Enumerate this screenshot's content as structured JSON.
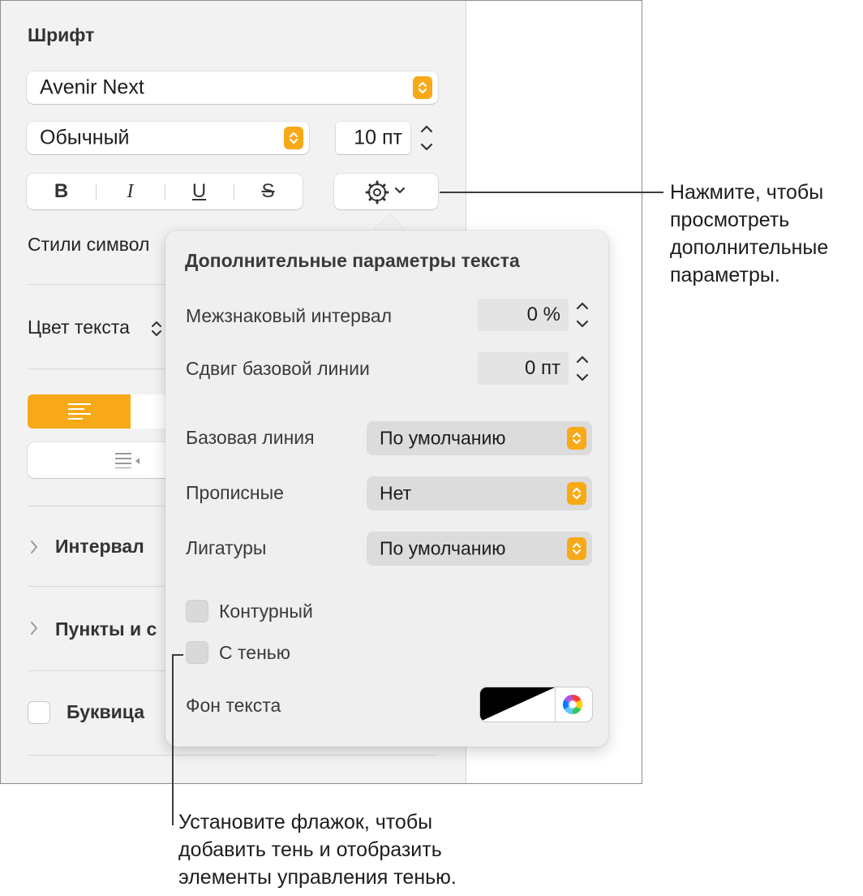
{
  "sidebar": {
    "font_header": "Шрифт",
    "font_family": "Avenir Next",
    "font_style": "Обычный",
    "font_size": "10 пт",
    "bold": "B",
    "italic": "I",
    "underline": "U",
    "strike": "S",
    "char_styles": "Стили символ",
    "text_color": "Цвет текста",
    "spacing": "Интервал",
    "bullets": "Пункты и с",
    "drop_cap": "Буквица"
  },
  "popover": {
    "title": "Дополнительные параметры текста",
    "char_spacing_label": "Межзнаковый интервал",
    "char_spacing_value": "0 %",
    "baseline_shift_label": "Сдвиг базовой линии",
    "baseline_shift_value": "0 пт",
    "baseline_label": "Базовая линия",
    "baseline_value": "По умолчанию",
    "caps_label": "Прописные",
    "caps_value": "Нет",
    "ligatures_label": "Лигатуры",
    "ligatures_value": "По умолчанию",
    "outline_label": "Контурный",
    "shadow_label": "С тенью",
    "text_bg_label": "Фон текста"
  },
  "callouts": {
    "gear_line1": "Нажмите, чтобы",
    "gear_line2": "просмотреть",
    "gear_line3": "дополнительные",
    "gear_line4": "параметры.",
    "shadow_line1": "Установите флажок, чтобы",
    "shadow_line2": "добавить тень и отобразить",
    "shadow_line3": "элементы управления тенью."
  },
  "colors": {
    "accent": "#f8a917",
    "popover_bg": "#efefef",
    "sidebar_bg": "#f2f2f2"
  }
}
